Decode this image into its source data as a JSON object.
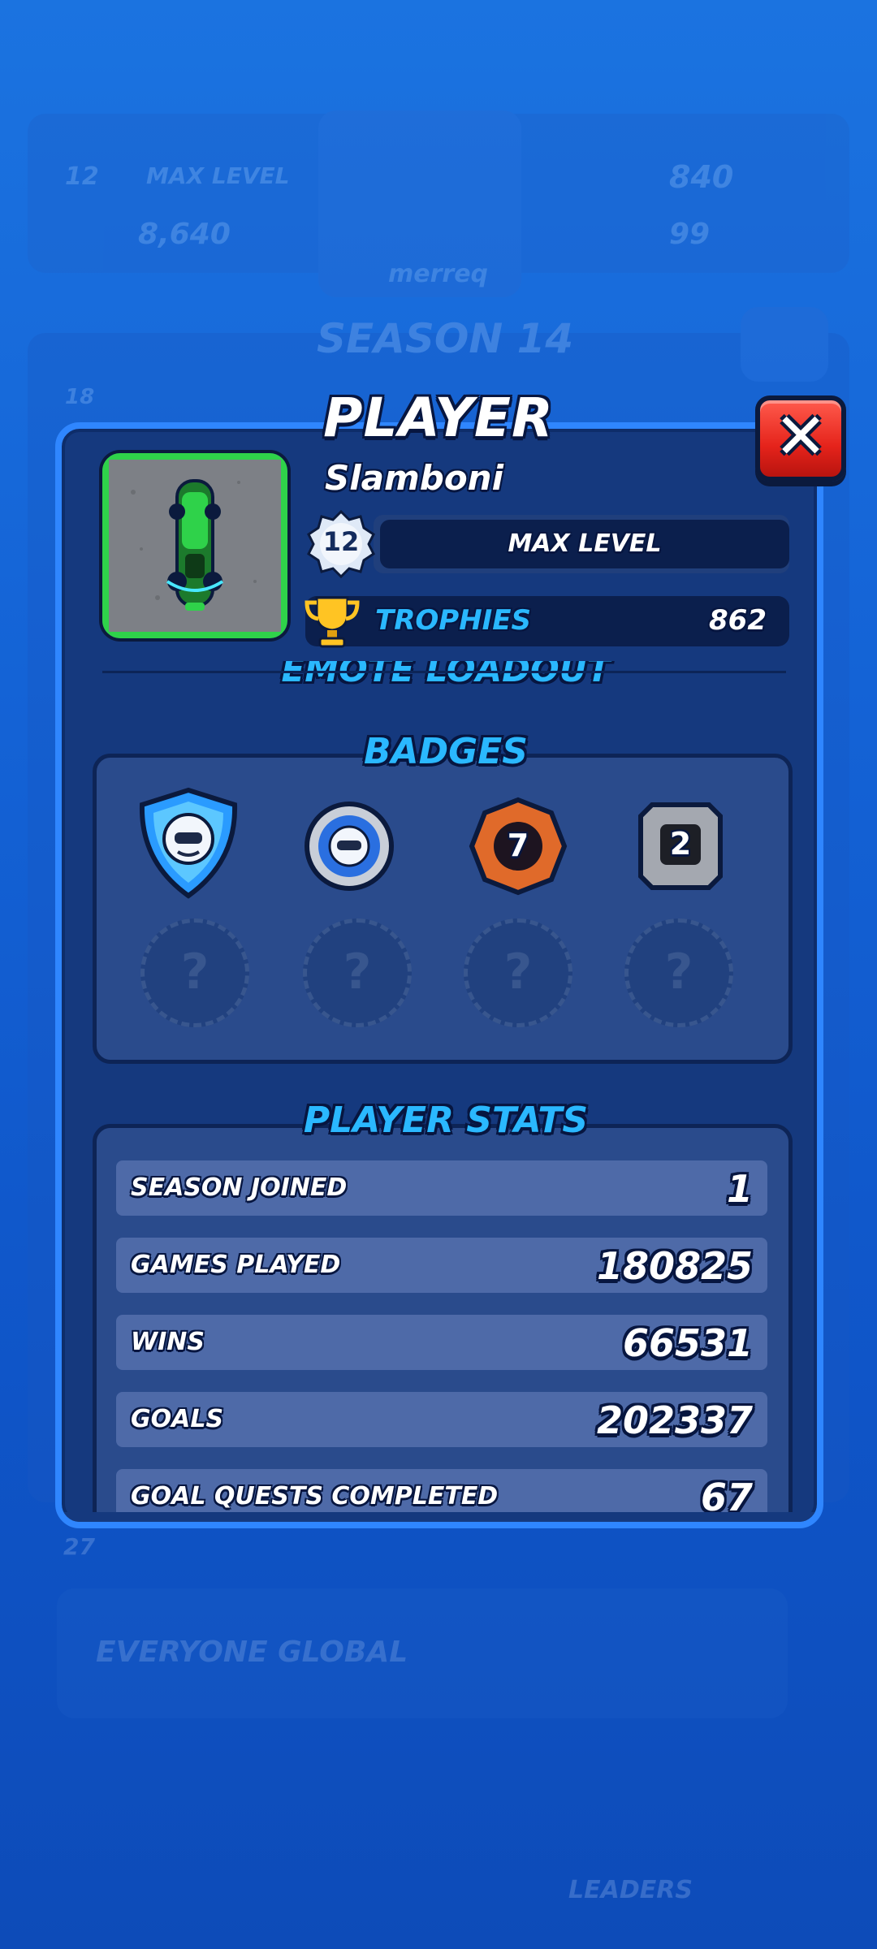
{
  "background": {
    "level": "12",
    "max_level_label": "MAX LEVEL",
    "trophies": "840",
    "coins": "8,640",
    "gems": "99",
    "username": "merreq",
    "season": "SEASON 14",
    "rank": "18",
    "leaderboard_rank": "27",
    "everyone_global": "EVERYONE GLOBAL",
    "leaders_label": "LEADERS"
  },
  "modal": {
    "title": "PLAYER",
    "player_name": "Slamboni",
    "level": "12",
    "max_level_label": "MAX LEVEL",
    "trophies_label": "TROPHIES",
    "trophies_value": "862",
    "emote_loadout_label": "EMOTE LOADOUT",
    "badges_title": "BADGES",
    "badges": [
      {
        "icon": "blue-shield-badge-icon",
        "value": ""
      },
      {
        "icon": "silver-round-badge-icon",
        "value": ""
      },
      {
        "icon": "bronze-badge-icon",
        "value": "7"
      },
      {
        "icon": "stone-badge-icon",
        "value": "2"
      }
    ],
    "locked_badge_symbol": "?",
    "stats_title": "PLAYER STATS",
    "stats": [
      {
        "label": "SEASON JOINED",
        "value": "1"
      },
      {
        "label": "GAMES PLAYED",
        "value": "180825"
      },
      {
        "label": "WINS",
        "value": "66531"
      },
      {
        "label": "GOALS",
        "value": "202337"
      },
      {
        "label": "GOAL QUESTS COMPLETED",
        "value": "67"
      }
    ],
    "close_symbol": "✕"
  },
  "colors": {
    "accent_blue": "#2ab8ff",
    "modal_bg": "#15397e",
    "close_red": "#e5231b",
    "avatar_border_green": "#2fd24a"
  }
}
